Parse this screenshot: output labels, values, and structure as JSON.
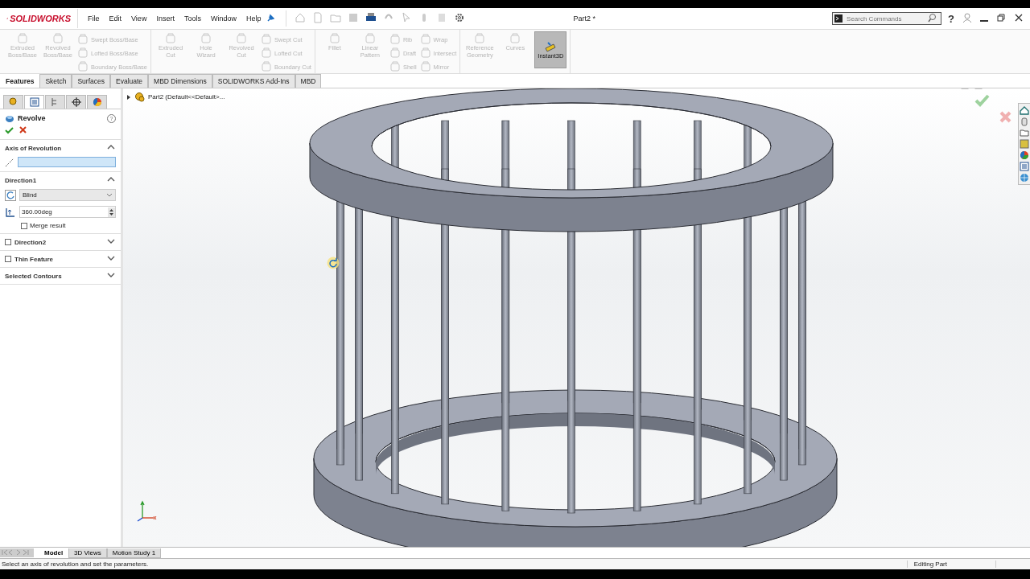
{
  "window": {
    "logo": "SOLIDWORKS",
    "menu": [
      "File",
      "Edit",
      "View",
      "Insert",
      "Tools",
      "Window",
      "Help"
    ],
    "title": "Part2 *",
    "help": "?",
    "search": {
      "placeholder": "Search Commands"
    }
  },
  "ribbon": {
    "groups": [
      {
        "items": [
          {
            "label": "Extruded Boss/Base",
            "kind": "large",
            "disabled": true
          },
          {
            "label": "Revolved Boss/Base",
            "kind": "large",
            "disabled": true
          },
          {
            "label": "Swept Boss/Base",
            "kind": "small",
            "disabled": true
          },
          {
            "label": "Lofted Boss/Base",
            "kind": "small",
            "disabled": true
          },
          {
            "label": "Boundary Boss/Base",
            "kind": "small",
            "disabled": true
          }
        ]
      },
      {
        "items": [
          {
            "label": "Extruded Cut",
            "kind": "large",
            "disabled": true
          },
          {
            "label": "Hole Wizard",
            "kind": "large",
            "disabled": true
          },
          {
            "label": "Revolved Cut",
            "kind": "large",
            "disabled": true
          },
          {
            "label": "Swept Cut",
            "kind": "small",
            "disabled": true
          },
          {
            "label": "Lofted Cut",
            "kind": "small",
            "disabled": true
          },
          {
            "label": "Boundary Cut",
            "kind": "small",
            "disabled": true
          }
        ]
      },
      {
        "items": [
          {
            "label": "Fillet",
            "kind": "large",
            "disabled": true
          },
          {
            "label": "Linear Pattern",
            "kind": "large",
            "disabled": true
          },
          {
            "label": "Rib",
            "kind": "small",
            "disabled": true
          },
          {
            "label": "Draft",
            "kind": "small",
            "disabled": true
          },
          {
            "label": "Shell",
            "kind": "small",
            "disabled": true
          },
          {
            "label": "Wrap",
            "kind": "small",
            "disabled": true
          },
          {
            "label": "Intersect",
            "kind": "small",
            "disabled": true
          },
          {
            "label": "Mirror",
            "kind": "small",
            "disabled": true
          }
        ]
      },
      {
        "items": [
          {
            "label": "Reference Geometry",
            "kind": "large",
            "disabled": true
          },
          {
            "label": "Curves",
            "kind": "large",
            "disabled": true
          },
          {
            "label": "Instant3D",
            "kind": "toggle",
            "disabled": false,
            "on": true
          }
        ]
      }
    ]
  },
  "command_tabs": [
    {
      "label": "Features",
      "selected": true
    },
    {
      "label": "Sketch",
      "selected": false
    },
    {
      "label": "Surfaces",
      "selected": false
    },
    {
      "label": "Evaluate",
      "selected": false
    },
    {
      "label": "MBD Dimensions",
      "selected": false
    },
    {
      "label": "SOLIDWORKS Add-Ins",
      "selected": false
    },
    {
      "label": "MBD",
      "selected": false
    }
  ],
  "property_manager": {
    "panel_tabs": [
      {
        "selected": false
      },
      {
        "selected": true
      },
      {
        "selected": false
      },
      {
        "selected": false
      },
      {
        "selected": false
      }
    ],
    "title": "Revolve",
    "help": "?",
    "sections": [
      {
        "kind": "axis",
        "title": "Axis of Revolution",
        "expanded": true
      },
      {
        "kind": "direction",
        "title": "Direction1",
        "expanded": true,
        "end_condition": "Blind",
        "angle": "360.00deg",
        "merge_label": "Merge result",
        "merge_checked": false
      },
      {
        "kind": "optional",
        "title": "Direction2",
        "checked": false,
        "expanded": false
      },
      {
        "kind": "optional",
        "title": "Thin Feature",
        "checked": false,
        "expanded": false
      },
      {
        "kind": "plain",
        "title": "Selected Contours",
        "expanded": false
      }
    ]
  },
  "feature_tree": {
    "label": "Part2 (Default<<Default>..."
  },
  "bottom_tabs": [
    {
      "label": "Model",
      "selected": true
    },
    {
      "label": "3D Views",
      "selected": false
    },
    {
      "label": "Motion Study 1",
      "selected": false
    }
  ],
  "status_bar": {
    "message": "Select an axis of revolution and set the parameters.",
    "mode": "Editing Part"
  }
}
